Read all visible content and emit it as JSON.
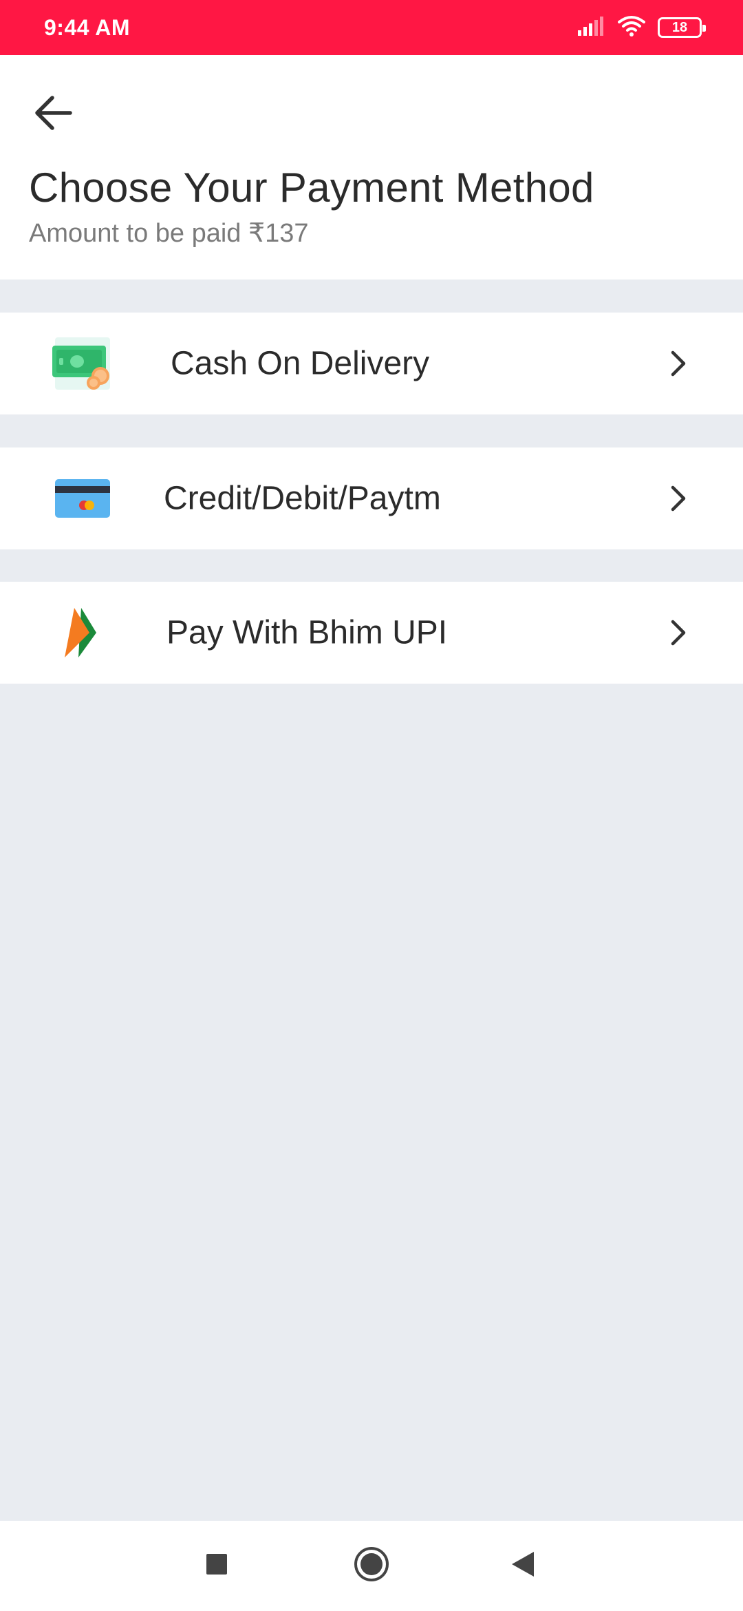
{
  "status_bar": {
    "time": "9:44 AM",
    "battery": "18",
    "background": "#ff1744"
  },
  "header": {
    "title": "Choose Your Payment Method",
    "subtitle": "Amount to be paid ₹137",
    "back_icon": "arrow-left-icon"
  },
  "payment_options": [
    {
      "label": "Cash On Delivery",
      "icon": "cash-icon"
    },
    {
      "label": "Credit/Debit/Paytm",
      "icon": "card-icon"
    },
    {
      "label": "Pay With Bhim UPI",
      "icon": "bhim-upi-icon"
    }
  ],
  "nav_bar": {
    "recent_icon": "square-icon",
    "home_icon": "circle-icon",
    "back_icon": "triangle-back-icon"
  },
  "colors": {
    "accent": "#ff1744",
    "page_background": "#e9ecf1",
    "text_primary": "#2b2b2b",
    "text_secondary": "#7a7a7a"
  }
}
